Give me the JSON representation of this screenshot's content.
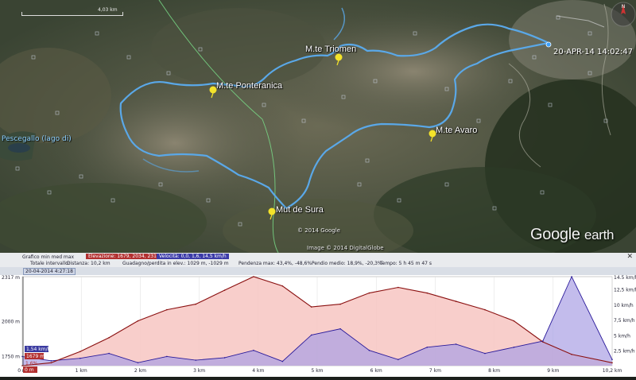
{
  "map": {
    "scale_label": "4,03 km",
    "waypoints": [
      {
        "name": "M.te Triomen"
      },
      {
        "name": "M.te Ponteranica"
      },
      {
        "name": "M.te Avaro"
      },
      {
        "name": "Mut de Sura"
      }
    ],
    "lake_label": "Pescegallo (lago di)",
    "date_stamp": "20-APR-14 14:02:47",
    "copyright_google": "© 2014 Google",
    "copyright_image": "Image © 2014 DigitalGlobe",
    "brand_main": "Google",
    "brand_sub": "earth"
  },
  "profile": {
    "stats": {
      "graph_label": "Grafico  min  med  max",
      "elevation": "Elevazione: 1679, 2034, 2317 m",
      "speed": "Velocità: 0,0, 1,6, 14,5 km/h",
      "total_label": "Totale intervallo:",
      "distance": "Distanza: 10,2 km",
      "gain": "Guadagno/perdita in elev.: 1029 m, -1029 m",
      "slope_max": "Pendenza max: 43,4%, -48,6%",
      "slope_avg": "Pendio medio: 18,9%, -20,3%",
      "time": "Tempo: 5 h 45 m 47 s",
      "close": "✕"
    },
    "date_marker": "20-04-2014 4:27:18",
    "left_axis": [
      "2317 m",
      "2000 m",
      "1750 m"
    ],
    "right_axis": [
      "14.5 km/h",
      "12,5 km/h",
      "10 km/h",
      "7,5 km/h",
      "5 km/h",
      "2,5 km/h"
    ],
    "x_ticks": [
      "0 m",
      "1 km",
      "2 km",
      "3 km",
      "4 km",
      "5 km",
      "6 km",
      "7 km",
      "8 km",
      "9 km",
      "10,2 km"
    ],
    "cursor_elevation": "1679 m",
    "cursor_speed": "1,54 km/h",
    "cursor_pct": "1,6%",
    "cursor_dist": "0 m",
    "colors": {
      "elevation_fill": "#f7c6c2",
      "elevation_line": "#8a1010",
      "speed_fill": "#aa9fe4",
      "speed_line": "#2a1a9a"
    }
  },
  "chart_data": {
    "type": "area",
    "series": [
      {
        "name": "Elevazione",
        "x_km": [
          0,
          0.5,
          1,
          1.5,
          2,
          2.5,
          3,
          3.5,
          4,
          4.5,
          5,
          5.5,
          6,
          6.5,
          7,
          7.5,
          8,
          8.5,
          9,
          9.5,
          10.2
        ],
        "values_m": [
          1679,
          1700,
          1780,
          1880,
          2000,
          2080,
          2120,
          2220,
          2317,
          2250,
          2100,
          2120,
          2200,
          2240,
          2200,
          2140,
          2080,
          2000,
          1850,
          1760,
          1700
        ]
      },
      {
        "name": "Velocità",
        "x_km": [
          0,
          0.5,
          1,
          1.5,
          2,
          2.5,
          3,
          3.5,
          4,
          4.5,
          5,
          5.5,
          6,
          6.5,
          7,
          7.5,
          8,
          8.5,
          9,
          9.5,
          10.2
        ],
        "values_kmh": [
          1.5,
          0.8,
          1.2,
          2.0,
          0.5,
          1.5,
          0.9,
          1.3,
          2.5,
          0.7,
          5.0,
          6.0,
          2.5,
          1.0,
          3.0,
          3.5,
          2.0,
          3.0,
          4.0,
          14.5,
          1.0
        ]
      }
    ],
    "xlim": [
      0,
      10.2
    ],
    "ylim_left": [
      1679,
      2317
    ],
    "ylim_right": [
      0,
      14.5
    ]
  }
}
